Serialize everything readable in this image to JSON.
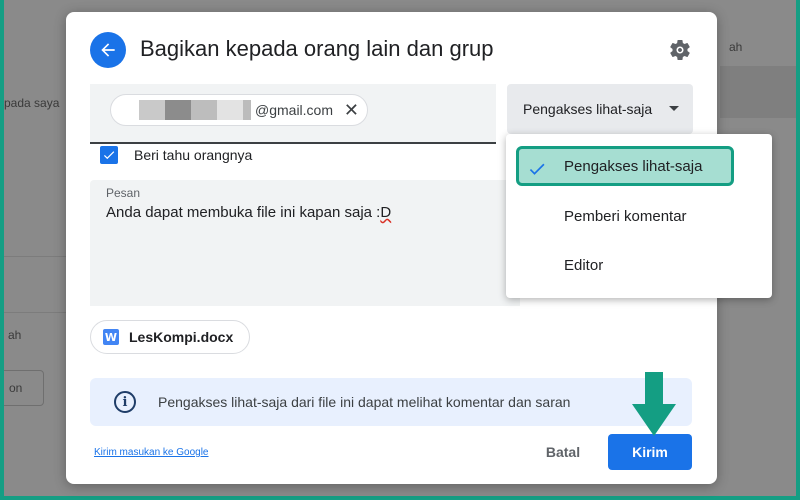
{
  "background": {
    "texts": [
      "pada saya",
      "ah",
      "ah",
      "on"
    ]
  },
  "dialog": {
    "title": "Bagikan kepada orang lain dan grup",
    "recipient": {
      "email_suffix": "@gmail.com"
    },
    "role_select": {
      "value": "Pengakses lihat-saja"
    },
    "notify": {
      "label": "Beri tahu orangnya",
      "checked": true
    },
    "message": {
      "label": "Pesan",
      "text_main": "Anda dapat membuka file ini kapan saja :",
      "text_end": "D"
    },
    "file": {
      "icon_letter": "W",
      "name": "LesKompi.docx"
    },
    "info": {
      "icon": "i",
      "text": "Pengakses lihat-saja dari file ini dapat melihat komentar dan saran"
    },
    "footer": {
      "feedback_link": "Kirim masukan ke Google",
      "cancel_label": "Batal",
      "send_label": "Kirim"
    }
  },
  "role_menu": {
    "items": [
      {
        "label": "Pengakses lihat-saja",
        "selected": true
      },
      {
        "label": "Pemberi komentar",
        "selected": false
      },
      {
        "label": "Editor",
        "selected": false
      }
    ]
  },
  "colors": {
    "accent": "#1a73e8",
    "frame": "#159e84",
    "highlight_fill": "#a6ded2",
    "highlight_border": "#149e83"
  }
}
